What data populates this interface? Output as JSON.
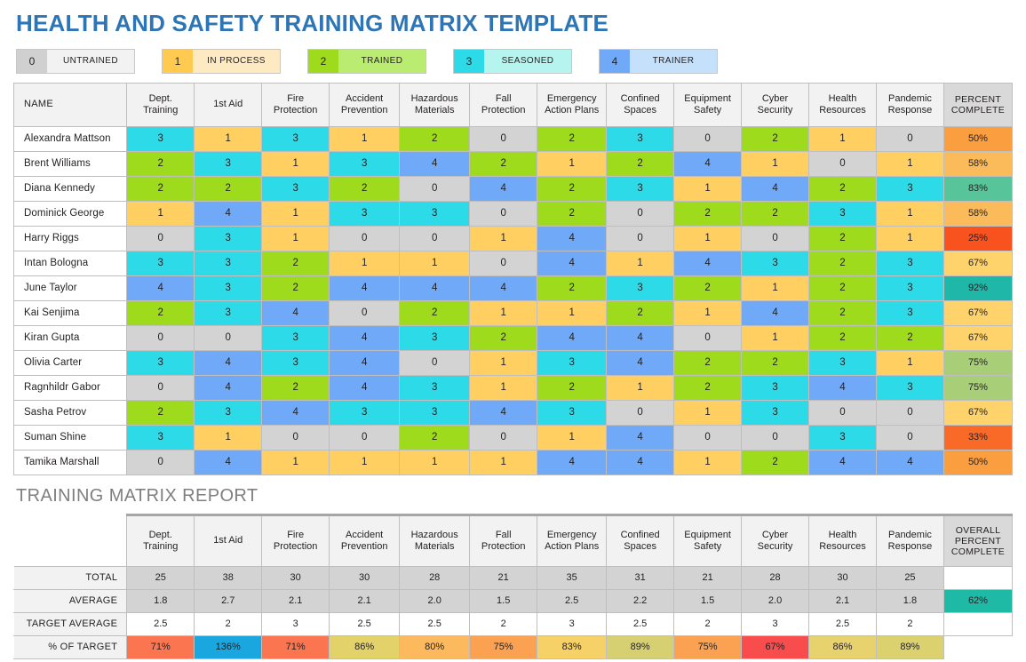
{
  "title": "HEALTH AND SAFETY TRAINING MATRIX TEMPLATE",
  "legend": [
    {
      "key": "0",
      "label": "UNTRAINED",
      "key_color": "#d0d0d0",
      "label_color": "#f2f2f2"
    },
    {
      "key": "1",
      "label": "IN PROCESS",
      "key_color": "#ffca4f",
      "label_color": "#fdeac2"
    },
    {
      "key": "2",
      "label": "TRAINED",
      "key_color": "#9ddb1c",
      "label_color": "#b9ec70"
    },
    {
      "key": "3",
      "label": "SEASONED",
      "key_color": "#2ddbe8",
      "label_color": "#b6f5ef"
    },
    {
      "key": "4",
      "label": "TRAINER",
      "key_color": "#70a9f7",
      "label_color": "#c5e0fb"
    }
  ],
  "matrix": {
    "name_header": "NAME",
    "columns": [
      "Dept. Training",
      "1st Aid",
      "Fire Protection",
      "Accident Prevention",
      "Hazardous Materials",
      "Fall Protection",
      "Emergency Action Plans",
      "Confined Spaces",
      "Equipment Safety",
      "Cyber Security",
      "Health Resources",
      "Pandemic Response"
    ],
    "percent_header": "PERCENT COMPLETE",
    "rows": [
      {
        "name": "Alexandra Mattson",
        "scores": [
          3,
          1,
          3,
          1,
          2,
          0,
          2,
          3,
          0,
          2,
          1,
          0
        ],
        "percent": "50%",
        "percent_color": "#fb9e3f"
      },
      {
        "name": "Brent Williams",
        "scores": [
          2,
          3,
          1,
          3,
          4,
          2,
          1,
          2,
          4,
          1,
          0,
          1
        ],
        "percent": "58%",
        "percent_color": "#fcbb5a"
      },
      {
        "name": "Diana Kennedy",
        "scores": [
          2,
          2,
          3,
          2,
          0,
          4,
          2,
          3,
          1,
          4,
          2,
          3
        ],
        "percent": "83%",
        "percent_color": "#57c49a"
      },
      {
        "name": "Dominick George",
        "scores": [
          1,
          4,
          1,
          3,
          3,
          0,
          2,
          0,
          2,
          2,
          3,
          1
        ],
        "percent": "58%",
        "percent_color": "#fcbb5a"
      },
      {
        "name": "Harry Riggs",
        "scores": [
          0,
          3,
          1,
          0,
          0,
          1,
          4,
          0,
          1,
          0,
          2,
          1
        ],
        "percent": "25%",
        "percent_color": "#f8521e"
      },
      {
        "name": "Intan Bologna",
        "scores": [
          3,
          3,
          2,
          1,
          1,
          0,
          4,
          1,
          4,
          3,
          2,
          3
        ],
        "percent": "67%",
        "percent_color": "#fed36b"
      },
      {
        "name": "June Taylor",
        "scores": [
          4,
          3,
          2,
          4,
          4,
          4,
          2,
          3,
          2,
          1,
          2,
          3
        ],
        "percent": "92%",
        "percent_color": "#1fb7a8"
      },
      {
        "name": "Kai Senjima",
        "scores": [
          2,
          3,
          4,
          0,
          2,
          1,
          1,
          2,
          1,
          4,
          2,
          3
        ],
        "percent": "67%",
        "percent_color": "#fed36b"
      },
      {
        "name": "Kiran Gupta",
        "scores": [
          0,
          0,
          3,
          4,
          3,
          2,
          4,
          4,
          0,
          1,
          2,
          2
        ],
        "percent": "67%",
        "percent_color": "#fed36b"
      },
      {
        "name": "Olivia Carter",
        "scores": [
          3,
          4,
          3,
          4,
          0,
          1,
          3,
          4,
          2,
          2,
          3,
          1
        ],
        "percent": "75%",
        "percent_color": "#a8ce78"
      },
      {
        "name": "Ragnhildr Gabor",
        "scores": [
          0,
          4,
          2,
          4,
          3,
          1,
          2,
          1,
          2,
          3,
          4,
          3
        ],
        "percent": "75%",
        "percent_color": "#a8ce78"
      },
      {
        "name": "Sasha Petrov",
        "scores": [
          2,
          3,
          4,
          3,
          3,
          4,
          3,
          0,
          1,
          3,
          0,
          0
        ],
        "percent": "67%",
        "percent_color": "#fed36b"
      },
      {
        "name": "Suman Shine",
        "scores": [
          3,
          1,
          0,
          0,
          2,
          0,
          1,
          4,
          0,
          0,
          3,
          0
        ],
        "percent": "33%",
        "percent_color": "#f96a28"
      },
      {
        "name": "Tamika Marshall",
        "scores": [
          0,
          4,
          1,
          1,
          1,
          1,
          4,
          4,
          1,
          2,
          4,
          4
        ],
        "percent": "50%",
        "percent_color": "#fb9e3f"
      }
    ]
  },
  "report": {
    "heading": "TRAINING MATRIX REPORT",
    "columns": [
      "Dept. Training",
      "1st Aid",
      "Fire Protection",
      "Accident Prevention",
      "Hazardous Materials",
      "Fall Protection",
      "Emergency Action Plans",
      "Confined Spaces",
      "Equipment Safety",
      "Cyber Security",
      "Health Resources",
      "Pandemic Response"
    ],
    "overall_header": "OVERALL PERCENT COMPLETE",
    "overall_value": "62%",
    "overall_color": "#1fbaa5",
    "rows": [
      {
        "label": "TOTAL",
        "values": [
          "25",
          "38",
          "30",
          "30",
          "28",
          "21",
          "35",
          "31",
          "21",
          "28",
          "30",
          "25"
        ]
      },
      {
        "label": "AVERAGE",
        "values": [
          "1.8",
          "2.7",
          "2.1",
          "2.1",
          "2.0",
          "1.5",
          "2.5",
          "2.2",
          "1.5",
          "2.0",
          "2.1",
          "1.8"
        ]
      },
      {
        "label": "TARGET AVERAGE",
        "values": [
          "2.5",
          "2",
          "3",
          "2.5",
          "2.5",
          "2",
          "3",
          "2.5",
          "2",
          "3",
          "2.5",
          "2"
        ]
      }
    ],
    "percent_of_target": {
      "label": "% OF TARGET",
      "values": [
        "71%",
        "136%",
        "71%",
        "86%",
        "80%",
        "75%",
        "83%",
        "89%",
        "75%",
        "67%",
        "86%",
        "89%"
      ],
      "colors": [
        "#fb7551",
        "#1aa7e0",
        "#fb7551",
        "#e3d16a",
        "#fcb95d",
        "#fba152",
        "#f5d168",
        "#d7d072",
        "#fba152",
        "#f94c4c",
        "#e7d26d",
        "#dbd16f"
      ]
    }
  }
}
